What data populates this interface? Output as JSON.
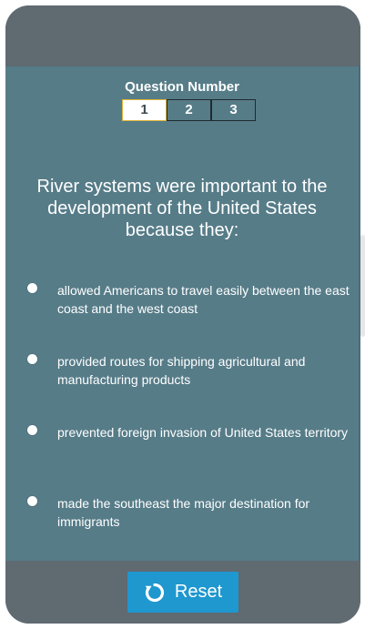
{
  "question_number": {
    "title": "Question Number",
    "numbers": [
      "1",
      "2",
      "3"
    ],
    "active": "1"
  },
  "question": {
    "text": "River systems were important to the development of the United States because they:"
  },
  "options": [
    {
      "text": "allowed Americans to travel easily between the east coast and the west coast"
    },
    {
      "text": "provided routes for shipping agricultural and manufacturing products"
    },
    {
      "text": "prevented foreign invasion of United States territory"
    },
    {
      "text": "made the southeast the major destination for immigrants"
    }
  ],
  "footer": {
    "reset_label": "Reset",
    "reset_icon": "reset-icon"
  },
  "colors": {
    "frame": "#5f6a71",
    "content": "#567c88",
    "button": "#1f97cf",
    "active_border": "#e0b43a"
  }
}
